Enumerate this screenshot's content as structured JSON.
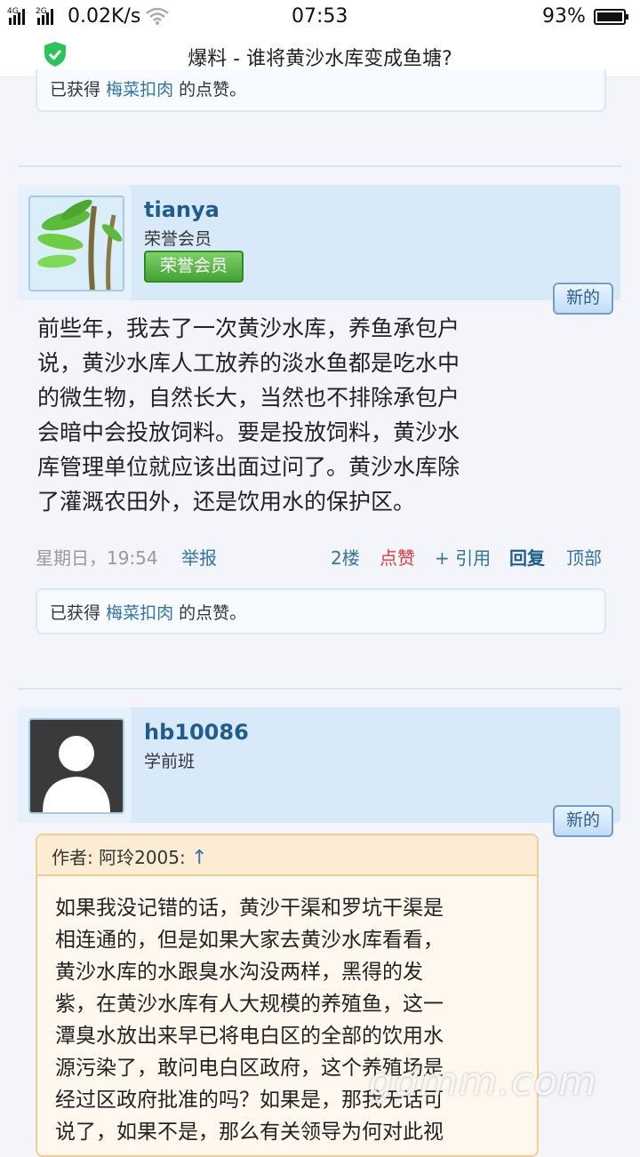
{
  "status_bar": {
    "network1": "4G",
    "network2": "2G",
    "speed": "0.02K/s",
    "time": "07:53",
    "battery": "93%"
  },
  "title_bar": {
    "title": "爆料 - 谁将黄沙水库变成鱼塘?",
    "icon": "shield-check-icon"
  },
  "top_like": {
    "prefix": "已获得",
    "link": "梅菜扣肉",
    "suffix": "的点赞。"
  },
  "post1": {
    "username": "tianya",
    "rank": "荣誉会员",
    "badge": "荣誉会员",
    "new_label": "新的",
    "avatar_icon": "bamboo-avatar-icon",
    "lines": [
      "前些年，我去了一次黄沙水库，养鱼承包户",
      "说，黄沙水库人工放养的淡水鱼都是吃水中",
      "的微生物，自然长大，当然也不排除承包户",
      "会暗中会投放饲料。要是投放饲料，黄沙水",
      "库管理单位就应该出面过问了。黄沙水库除",
      "了灌溉农田外，还是饮用水的保护区。"
    ],
    "date": "星期日，19:54",
    "report": "举报",
    "floor": "2楼",
    "like": "点赞",
    "quote": "+ 引用",
    "reply": "回复",
    "top": "顶部",
    "like_prefix": "已获得",
    "like_link": "梅菜扣肉",
    "like_suffix": "的点赞。"
  },
  "post2": {
    "username": "hb10086",
    "rank": "学前班",
    "new_label": "新的",
    "avatar_icon": "default-user-avatar-icon",
    "quote_author": "作者: 阿玲2005:",
    "quote_arrow": "↑",
    "quote_lines": [
      "如果我没记错的话，黄沙干渠和罗坑干渠是",
      "相连通的，但是如果大家去黄沙水库看看，",
      "黄沙水库的水跟臭水沟没两样，黑得的发",
      "紫，在黄沙水库有人大规模的养殖鱼，这一",
      "潭臭水放出来早已将电白区的全部的饮用水",
      "源污染了，敢问电白区政府，这个养殖场是",
      "经过区政府批准的吗？如果是，那我无话可",
      "说了，如果不是，那么有关领导为何对此视"
    ]
  },
  "watermark": "gdmm.com",
  "colors": {
    "link": "#3273a8",
    "like_red": "#e03a3a",
    "header_bg": "#d8e9fa",
    "quote_border": "#f1cf94"
  }
}
